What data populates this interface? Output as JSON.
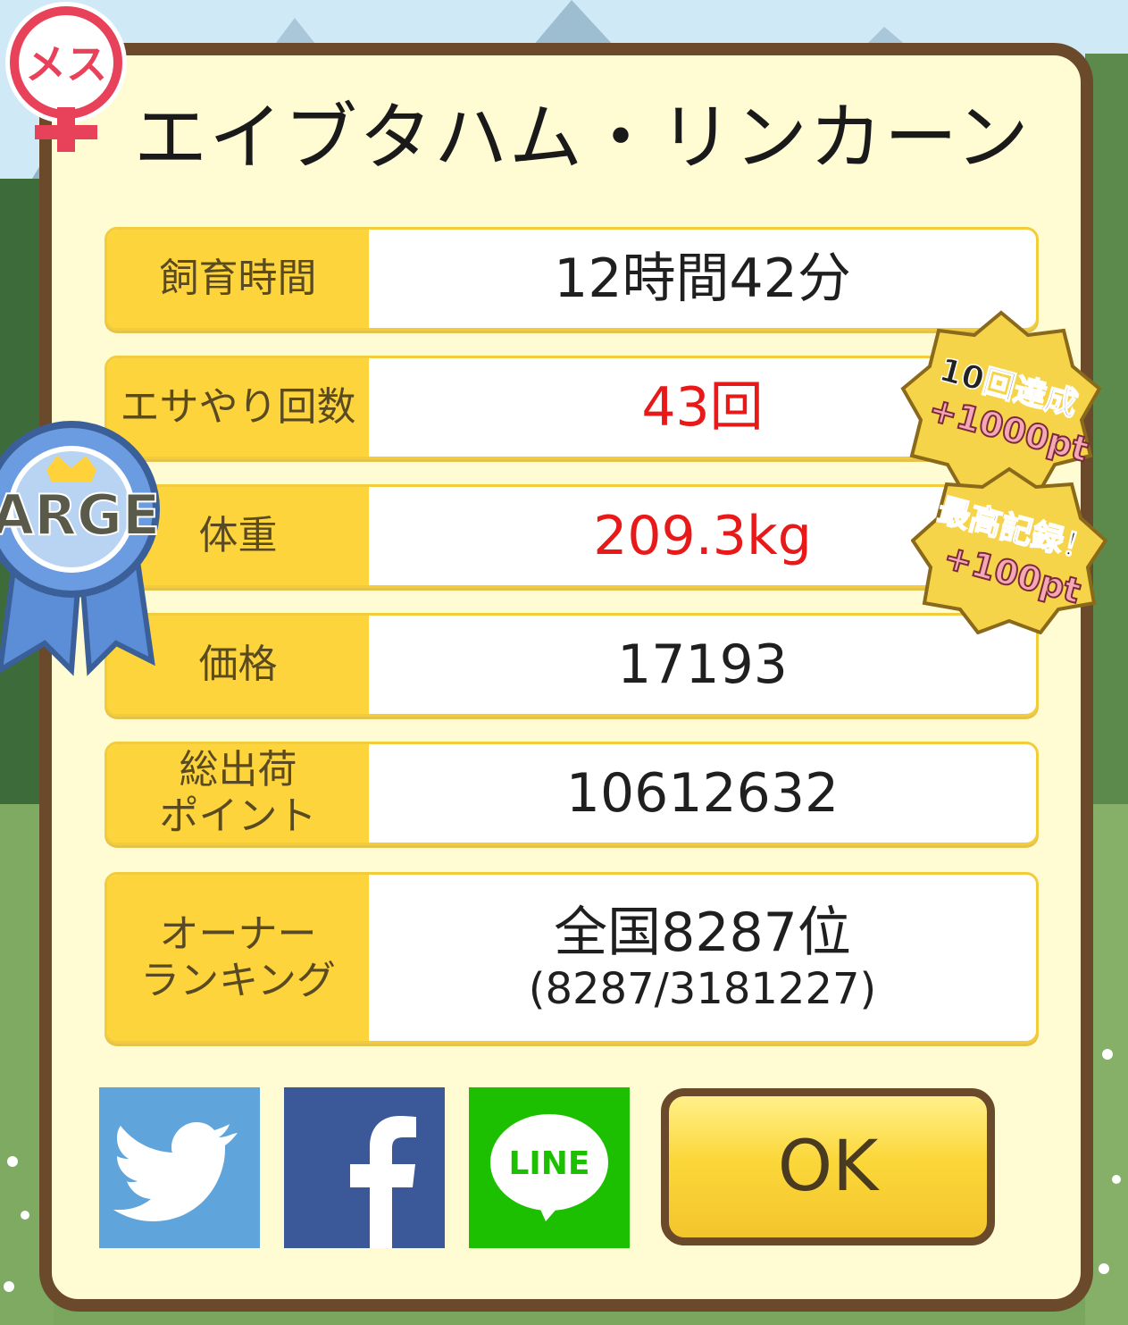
{
  "gender_badge": "メス",
  "size_ribbon": "LARGE",
  "hamster_name": "エイブタハム・リンカーン",
  "stats": [
    {
      "label": "飼育時間",
      "value": "12時間42分",
      "highlight": false
    },
    {
      "label": "エサやり回数",
      "value": "43回",
      "highlight": true
    },
    {
      "label": "体重",
      "value": "209.3kg",
      "highlight": true
    },
    {
      "label": "価格",
      "value": "17193",
      "highlight": false
    },
    {
      "label": "総出荷\nポイント",
      "value": "10612632",
      "highlight": false
    },
    {
      "label": "オーナー\nランキング",
      "value": "全国8287位",
      "subvalue": "(8287/3181227)",
      "highlight": false
    }
  ],
  "medals": [
    {
      "line1": "10回達成",
      "line2": "+1000pt"
    },
    {
      "line1": "最高記録！",
      "line2": "+100pt"
    }
  ],
  "share": {
    "twitter_icon": "twitter-icon",
    "facebook_icon": "facebook-icon",
    "line_label": "LINE"
  },
  "ok_label": "OK",
  "colors": {
    "panel_bg": "#fffbd3",
    "panel_border": "#6b4a2b",
    "label_bg": "#fdd43b",
    "highlight_text": "#e81919",
    "twitter": "#5fa5dc",
    "facebook": "#3b5898",
    "line": "#1dc000"
  }
}
